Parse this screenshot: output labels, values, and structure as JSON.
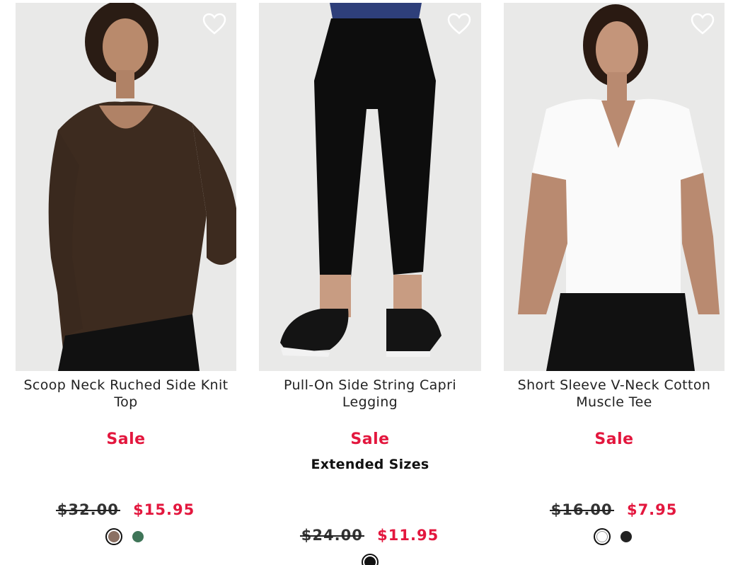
{
  "products": [
    {
      "name": "Scoop Neck Ruched Side Knit Top",
      "badge": "Sale",
      "extended": "",
      "original_price": "$32.00",
      "sale_price": "$15.95",
      "swatches": [
        {
          "color": "#8b7164",
          "selected": true
        },
        {
          "color": "#3f7558",
          "selected": false
        }
      ]
    },
    {
      "name": "Pull-On Side String Capri Legging",
      "badge": "Sale",
      "extended": "Extended Sizes",
      "original_price": "$24.00",
      "sale_price": "$11.95",
      "swatches": [
        {
          "color": "#111111",
          "selected": true
        }
      ]
    },
    {
      "name": "Short Sleeve V-Neck Cotton Muscle Tee",
      "badge": "Sale",
      "extended": "",
      "original_price": "$16.00",
      "sale_price": "$7.95",
      "swatches": [
        {
          "color": "#ffffff",
          "selected": true
        },
        {
          "color": "#222222",
          "selected": false
        }
      ]
    }
  ],
  "icons": {
    "favorite": "heart-outline-icon"
  },
  "colors": {
    "sale": "#e3173e",
    "image_bg": "#e9e9e8"
  }
}
